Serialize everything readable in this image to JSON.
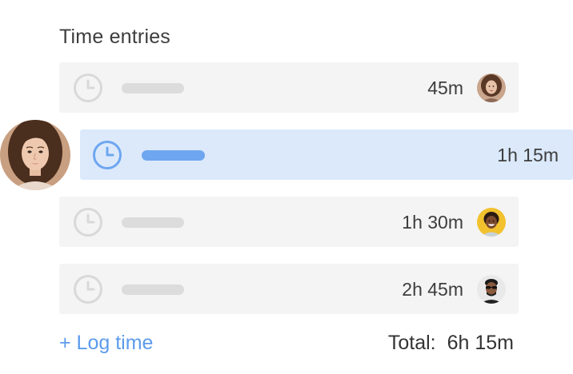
{
  "header": {
    "title": "Time entries"
  },
  "entries": [
    {
      "duration": "45m",
      "avatar": "woman-curly-hair-avatar",
      "selected": false
    },
    {
      "duration": "1h 15m",
      "avatar": "woman-long-hair-avatar",
      "selected": true
    },
    {
      "duration": "1h 30m",
      "avatar": "smiling-woman-yellow-avatar",
      "selected": false
    },
    {
      "duration": "2h 45m",
      "avatar": "man-sunglasses-avatar",
      "selected": false
    }
  ],
  "footer": {
    "log_time_label": "+ Log time",
    "total_label": "Total:",
    "total_value": "6h 15m"
  },
  "colors": {
    "accent": "#5b9bec",
    "selected_row_bg": "#dbe9fb",
    "row_bg": "#f4f4f4",
    "placeholder_bar": "#dcdcdc",
    "active_bar": "#6ea6ef"
  }
}
